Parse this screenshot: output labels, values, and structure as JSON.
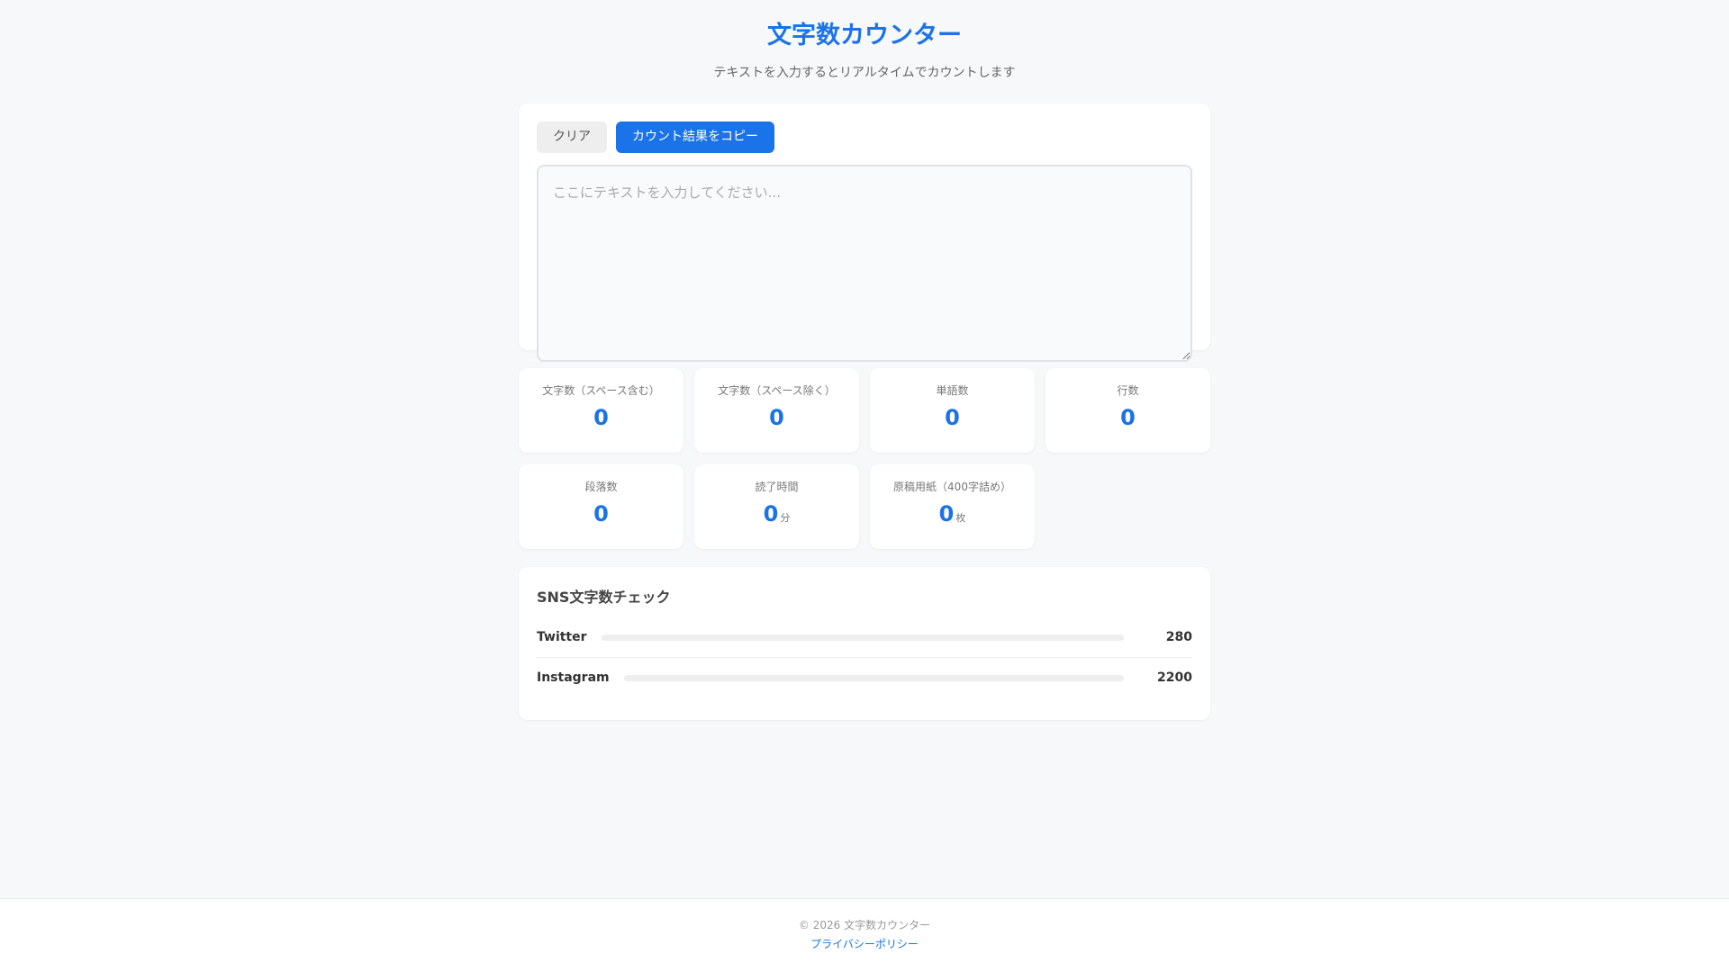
{
  "header": {
    "title": "文字数カウンター",
    "subtitle": "テキストを入力するとリアルタイムでカウントします"
  },
  "toolbar": {
    "clear_label": "クリア",
    "copy_label": "カウント結果をコピー"
  },
  "editor": {
    "value": "",
    "placeholder": "ここにテキストを入力してください..."
  },
  "stats": [
    {
      "label": "文字数（スペース含む）",
      "value": "0",
      "unit": ""
    },
    {
      "label": "文字数（スペース除く）",
      "value": "0",
      "unit": ""
    },
    {
      "label": "単語数",
      "value": "0",
      "unit": ""
    },
    {
      "label": "行数",
      "value": "0",
      "unit": ""
    },
    {
      "label": "段落数",
      "value": "0",
      "unit": ""
    },
    {
      "label": "読了時間",
      "value": "0",
      "unit": "分"
    },
    {
      "label": "原稿用紙（400字詰め）",
      "value": "0",
      "unit": "枚"
    }
  ],
  "sns": {
    "title": "SNS文字数チェック",
    "items": [
      {
        "name": "Twitter",
        "limit": "280",
        "used_fraction": 0
      },
      {
        "name": "Instagram",
        "limit": "2200",
        "used_fraction": 0
      }
    ]
  },
  "footer": {
    "copyright": "© 2026 文字数カウンター",
    "privacy_label": "プライバシーポリシー"
  },
  "colors": {
    "accent": "#1a73e8",
    "background": "#f7f8fa"
  }
}
